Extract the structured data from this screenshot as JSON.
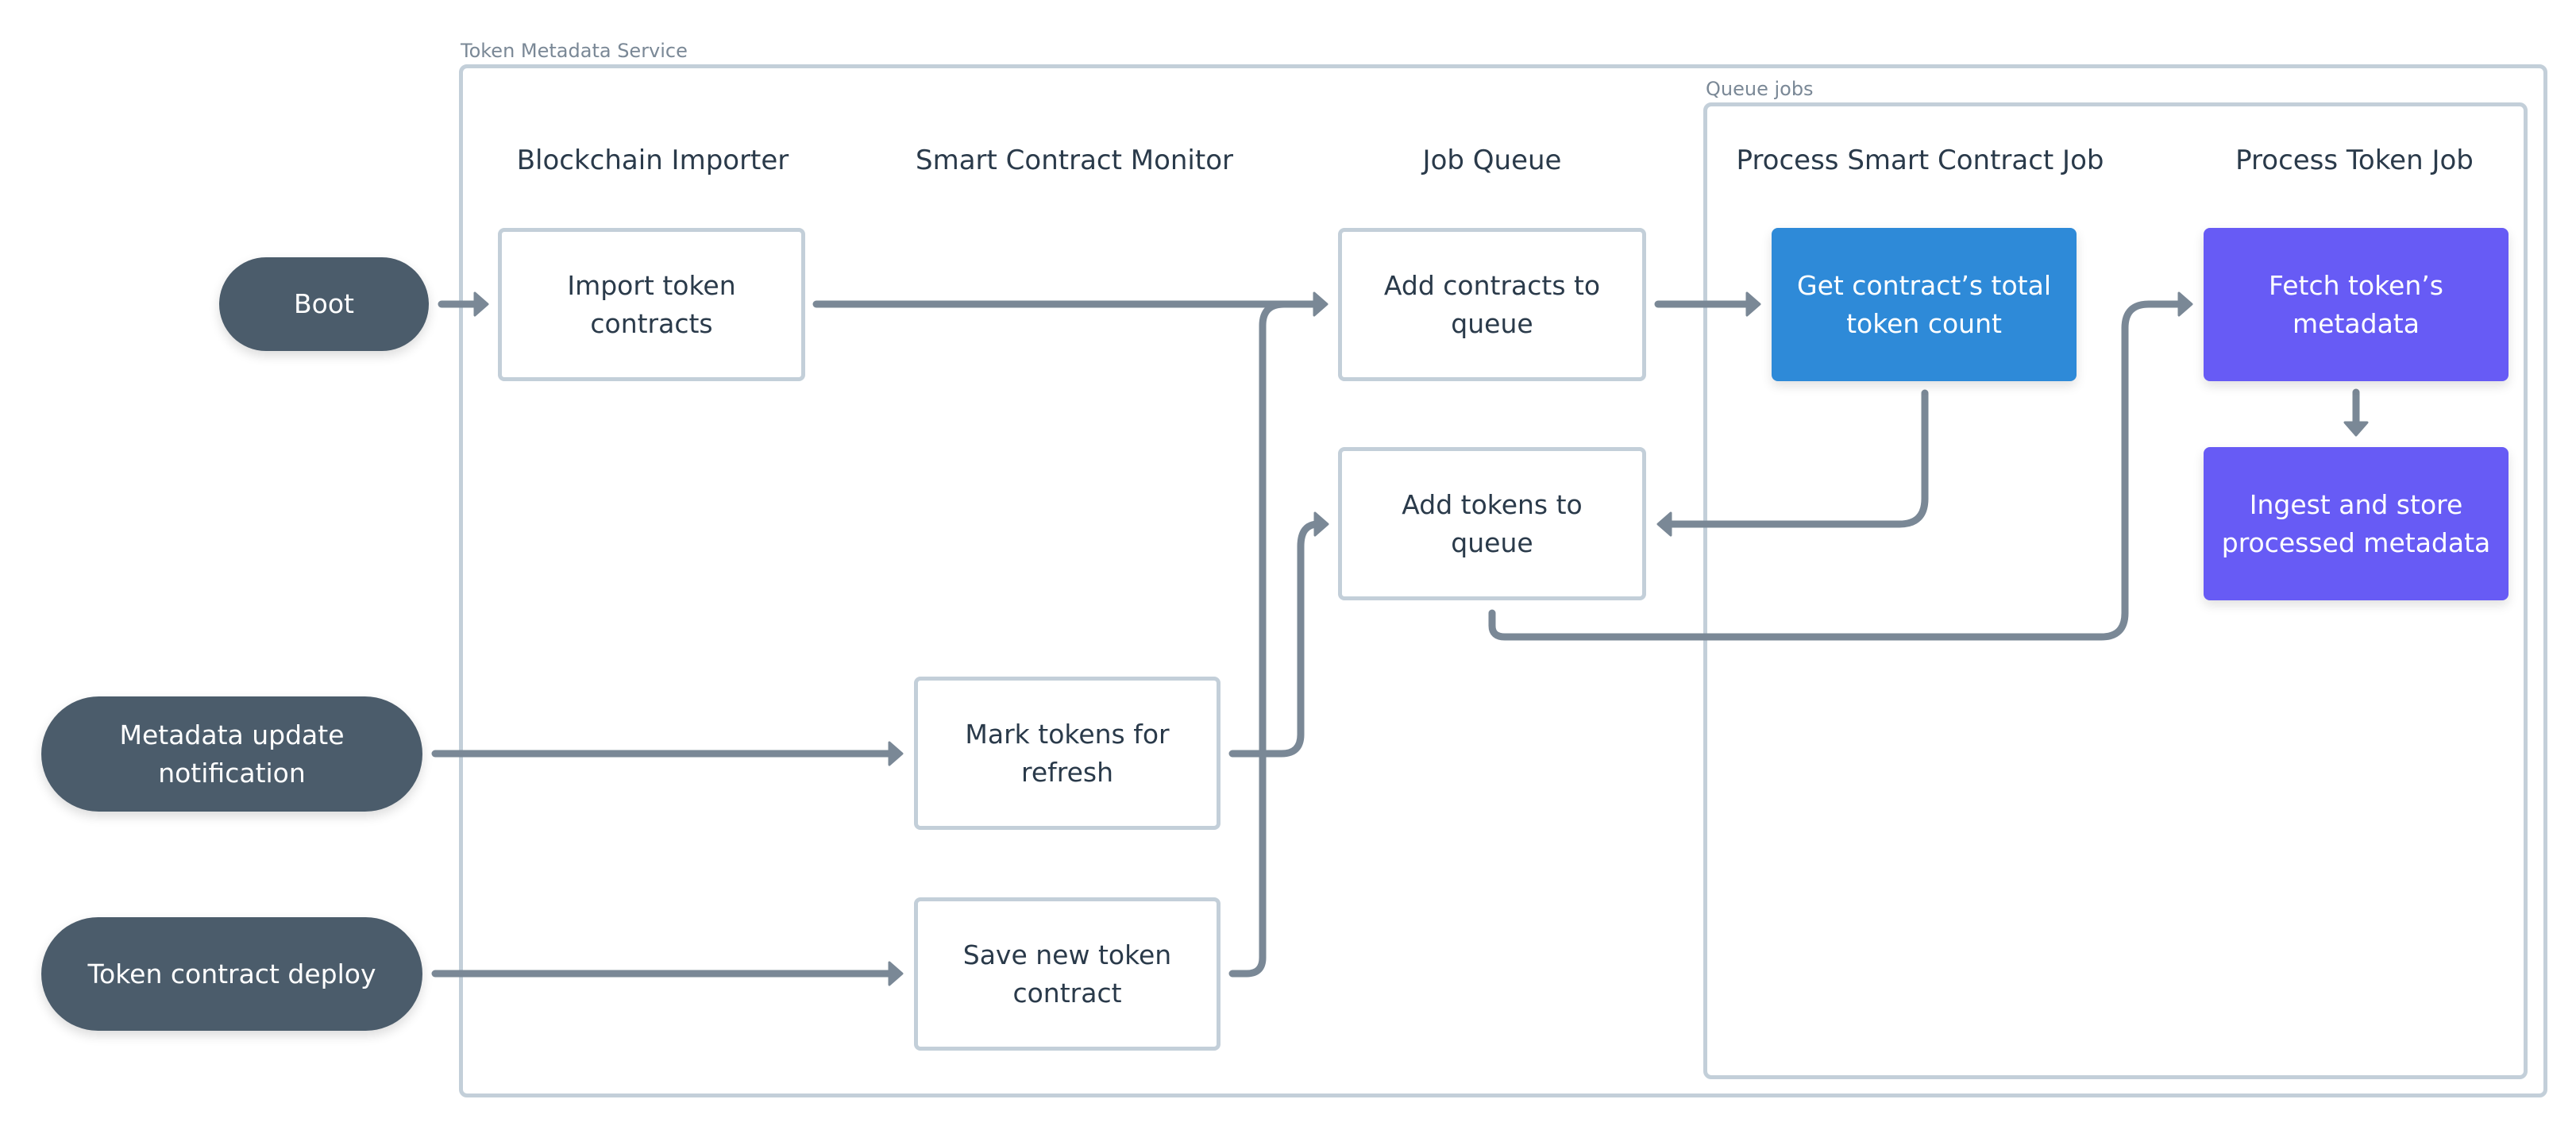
{
  "groups": {
    "service": {
      "label": "Token Metadata Service"
    },
    "queue_jobs": {
      "label": "Queue jobs"
    }
  },
  "columns": [
    {
      "title": "Blockchain Importer"
    },
    {
      "title": "Smart Contract Monitor"
    },
    {
      "title": "Job Queue"
    },
    {
      "title": "Process Smart Contract Job"
    },
    {
      "title": "Process Token Job"
    }
  ],
  "triggers": {
    "boot": "Boot",
    "metadata_update": [
      "Metadata update",
      "notification"
    ],
    "contract_deploy": "Token contract deploy"
  },
  "steps": {
    "import_contracts": [
      "Import token",
      "contracts"
    ],
    "mark_tokens": [
      "Mark tokens for",
      "refresh"
    ],
    "save_contract": [
      "Save new token",
      "contract"
    ],
    "add_contracts": [
      "Add contracts to",
      "queue"
    ],
    "add_tokens": "Add tokens to queue",
    "get_count": [
      "Get contract’s total",
      "token count"
    ],
    "fetch_metadata": [
      "Fetch token’s",
      "metadata"
    ],
    "ingest_metadata": [
      "Ingest and store",
      "processed metadata"
    ]
  },
  "colors": {
    "trigger": "#4b5c6b",
    "contract_job": "#2e8ad8",
    "token_job": "#675bf5",
    "connector": "#7a8896",
    "border": "#c3cfd9"
  },
  "edges": [
    {
      "from": "Boot",
      "to": "Import token contracts"
    },
    {
      "from": "Import token contracts",
      "to": "Add contracts to queue"
    },
    {
      "from": "Save new token contract",
      "to": "Add contracts to queue"
    },
    {
      "from": "Metadata update notification",
      "to": "Mark tokens for refresh"
    },
    {
      "from": "Mark tokens for refresh",
      "to": "Add tokens to queue"
    },
    {
      "from": "Token contract deploy",
      "to": "Save new token contract"
    },
    {
      "from": "Add contracts to queue",
      "to": "Get contract's total token count"
    },
    {
      "from": "Get contract's total token count",
      "to": "Add tokens to queue"
    },
    {
      "from": "Add tokens to queue",
      "to": "Fetch token's metadata"
    },
    {
      "from": "Fetch token's metadata",
      "to": "Ingest and store processed metadata"
    }
  ]
}
